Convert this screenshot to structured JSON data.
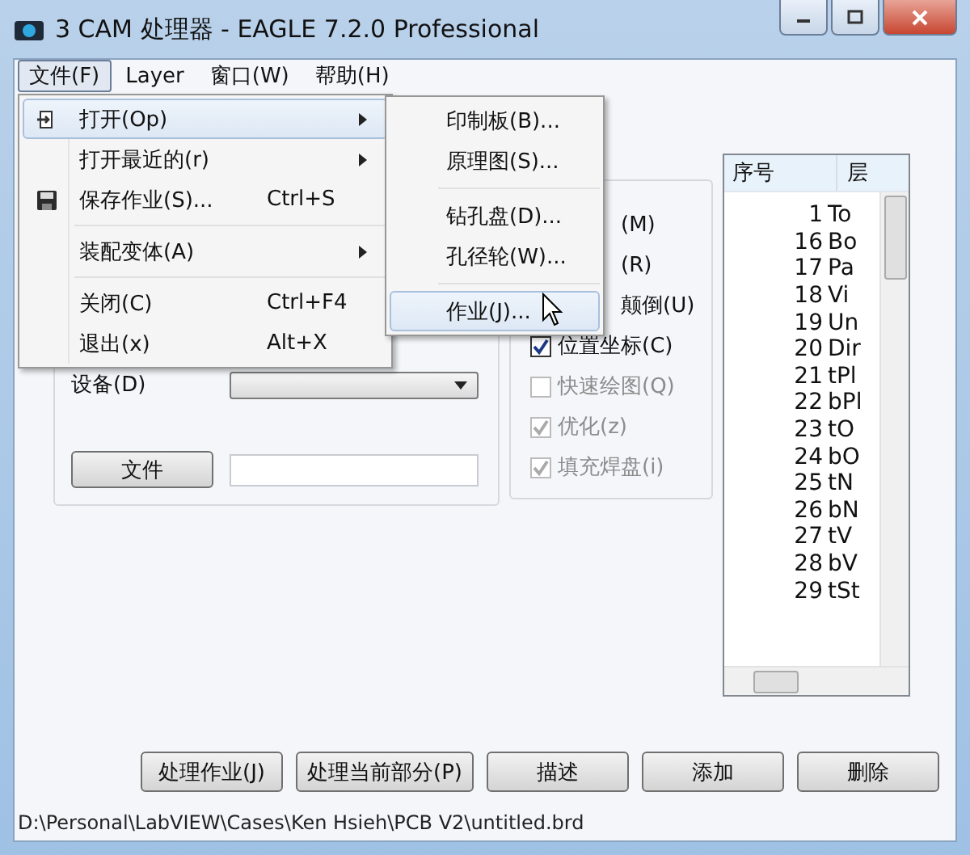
{
  "window": {
    "title": "3 CAM 处理器 - EAGLE 7.2.0 Professional"
  },
  "menu_bar": [
    {
      "label": "文件(F)",
      "selected": true
    },
    {
      "label": "Layer",
      "selected": false
    },
    {
      "label": "窗口(W)",
      "selected": false
    },
    {
      "label": "帮助(H)",
      "selected": false
    }
  ],
  "file_menu": [
    {
      "kind": "item",
      "label": "打开(Op)",
      "submenu": true,
      "selected": true
    },
    {
      "kind": "item",
      "label": "打开最近的(r)",
      "submenu": true,
      "selected": false
    },
    {
      "kind": "item",
      "label": "保存作业(S)...",
      "shortcut": "Ctrl+S",
      "submenu": false,
      "selected": false
    },
    {
      "kind": "separator"
    },
    {
      "kind": "item",
      "label": "装配变体(A)",
      "submenu": true,
      "selected": false
    },
    {
      "kind": "separator"
    },
    {
      "kind": "item",
      "label": "关闭(C)",
      "shortcut": "Ctrl+F4",
      "submenu": false,
      "selected": false
    },
    {
      "kind": "item",
      "label": "退出(x)",
      "shortcut": "Alt+X",
      "submenu": false,
      "selected": false
    }
  ],
  "open_submenu": [
    {
      "kind": "item",
      "label": "印制板(B)...",
      "selected": false
    },
    {
      "kind": "item",
      "label": "原理图(S)...",
      "selected": false
    },
    {
      "kind": "separator"
    },
    {
      "kind": "item",
      "label": "钻孔盘(D)...",
      "selected": false
    },
    {
      "kind": "item",
      "label": "孔径轮(W)...",
      "selected": false
    },
    {
      "kind": "separator"
    },
    {
      "kind": "item",
      "label": "作业(J)...",
      "selected": true
    }
  ],
  "device": {
    "label": "设备(D)"
  },
  "file_button": "文件",
  "options": [
    {
      "kind": "partial",
      "label": "(M)"
    },
    {
      "kind": "partial",
      "label": "(R)"
    },
    {
      "kind": "partial",
      "label": "颠倒(U)"
    },
    {
      "kind": "checkbox",
      "label": "位置坐标(C)",
      "checked": true,
      "disabled": false
    },
    {
      "kind": "checkbox",
      "label": "快速绘图(Q)",
      "checked": false,
      "disabled": true
    },
    {
      "kind": "checkbox",
      "label": "优化(z)",
      "checked": true,
      "disabled": true
    },
    {
      "kind": "checkbox",
      "label": "填充焊盘(i)",
      "checked": true,
      "disabled": true
    }
  ],
  "layer_list": {
    "columns": [
      "序号",
      "层"
    ],
    "rows": [
      [
        "1",
        "To"
      ],
      [
        "16",
        "Bo"
      ],
      [
        "17",
        "Pa"
      ],
      [
        "18",
        "Vi"
      ],
      [
        "19",
        "Un"
      ],
      [
        "20",
        "Dir"
      ],
      [
        "21",
        "tPl"
      ],
      [
        "22",
        "bPl"
      ],
      [
        "23",
        "tO"
      ],
      [
        "24",
        "bO"
      ],
      [
        "25",
        "tN"
      ],
      [
        "26",
        "bN"
      ],
      [
        "27",
        "tV"
      ],
      [
        "28",
        "bV"
      ],
      [
        "29",
        "tSt"
      ]
    ]
  },
  "buttons": [
    "处理作业(J)",
    "处理当前部分(P)",
    "描述",
    "添加",
    "删除"
  ],
  "status_bar": "D:\\Personal\\LabVIEW\\Cases\\Ken Hsieh\\PCB V2\\untitled.brd"
}
